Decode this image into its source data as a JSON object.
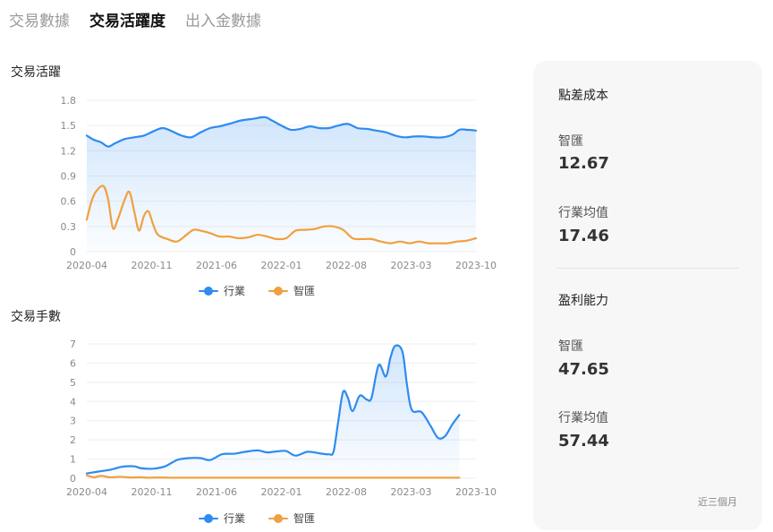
{
  "tabs": [
    {
      "label": "交易數據",
      "active": false
    },
    {
      "label": "交易活躍度",
      "active": true
    },
    {
      "label": "出入金數據",
      "active": false
    }
  ],
  "colors": {
    "industry": "#2e8bf0",
    "zhihui": "#f0a040"
  },
  "legend": {
    "industry": "行業",
    "zhihui": "智匯"
  },
  "chart_data": [
    {
      "type": "area",
      "title": "交易活躍",
      "ylim": [
        0,
        1.8
      ],
      "yticks": [
        "0",
        "0.3",
        "0.6",
        "0.9",
        "1.2",
        "1.5",
        "1.8"
      ],
      "xticks": [
        "2020-04",
        "2020-11",
        "2021-06",
        "2022-01",
        "2022-08",
        "2023-03",
        "2023-10"
      ],
      "series": [
        {
          "name": "行業",
          "color": "#2e8bf0",
          "fill": true,
          "points": [
            [
              0,
              1.38
            ],
            [
              0.3,
              1.33
            ],
            [
              0.6,
              1.3
            ],
            [
              0.9,
              1.25
            ],
            [
              1.2,
              1.29
            ],
            [
              1.6,
              1.34
            ],
            [
              2.0,
              1.36
            ],
            [
              2.4,
              1.38
            ],
            [
              2.8,
              1.43
            ],
            [
              3.2,
              1.47
            ],
            [
              3.6,
              1.43
            ],
            [
              4.0,
              1.38
            ],
            [
              4.4,
              1.36
            ],
            [
              4.8,
              1.42
            ],
            [
              5.2,
              1.47
            ],
            [
              5.6,
              1.49
            ],
            [
              6.0,
              1.52
            ],
            [
              6.5,
              1.56
            ],
            [
              7.0,
              1.58
            ],
            [
              7.5,
              1.6
            ],
            [
              7.8,
              1.56
            ],
            [
              8.2,
              1.5
            ],
            [
              8.6,
              1.45
            ],
            [
              9.0,
              1.46
            ],
            [
              9.4,
              1.49
            ],
            [
              9.8,
              1.47
            ],
            [
              10.2,
              1.47
            ],
            [
              10.6,
              1.5
            ],
            [
              11.0,
              1.52
            ],
            [
              11.4,
              1.47
            ],
            [
              11.8,
              1.46
            ],
            [
              12.2,
              1.44
            ],
            [
              12.6,
              1.42
            ],
            [
              13.0,
              1.38
            ],
            [
              13.4,
              1.36
            ],
            [
              13.8,
              1.37
            ],
            [
              14.2,
              1.37
            ],
            [
              14.6,
              1.36
            ],
            [
              15.0,
              1.36
            ],
            [
              15.4,
              1.39
            ],
            [
              15.7,
              1.45
            ],
            [
              16.0,
              1.45
            ],
            [
              16.4,
              1.44
            ]
          ]
        },
        {
          "name": "智匯",
          "color": "#f0a040",
          "fill": false,
          "points": [
            [
              0,
              0.38
            ],
            [
              0.2,
              0.6
            ],
            [
              0.4,
              0.72
            ],
            [
              0.7,
              0.78
            ],
            [
              0.9,
              0.62
            ],
            [
              1.1,
              0.28
            ],
            [
              1.3,
              0.38
            ],
            [
              1.6,
              0.62
            ],
            [
              1.8,
              0.71
            ],
            [
              2.0,
              0.48
            ],
            [
              2.2,
              0.25
            ],
            [
              2.4,
              0.42
            ],
            [
              2.6,
              0.48
            ],
            [
              2.8,
              0.32
            ],
            [
              3.0,
              0.2
            ],
            [
              3.4,
              0.15
            ],
            [
              3.8,
              0.12
            ],
            [
              4.2,
              0.2
            ],
            [
              4.5,
              0.26
            ],
            [
              4.8,
              0.25
            ],
            [
              5.2,
              0.22
            ],
            [
              5.6,
              0.18
            ],
            [
              6.0,
              0.18
            ],
            [
              6.4,
              0.16
            ],
            [
              6.8,
              0.17
            ],
            [
              7.2,
              0.2
            ],
            [
              7.6,
              0.18
            ],
            [
              8.0,
              0.15
            ],
            [
              8.4,
              0.16
            ],
            [
              8.8,
              0.25
            ],
            [
              9.2,
              0.26
            ],
            [
              9.6,
              0.27
            ],
            [
              10.0,
              0.3
            ],
            [
              10.4,
              0.3
            ],
            [
              10.8,
              0.26
            ],
            [
              11.2,
              0.16
            ],
            [
              11.6,
              0.15
            ],
            [
              12.0,
              0.15
            ],
            [
              12.4,
              0.12
            ],
            [
              12.8,
              0.1
            ],
            [
              13.2,
              0.12
            ],
            [
              13.6,
              0.1
            ],
            [
              14.0,
              0.12
            ],
            [
              14.4,
              0.1
            ],
            [
              14.8,
              0.1
            ],
            [
              15.2,
              0.1
            ],
            [
              15.6,
              0.12
            ],
            [
              16.0,
              0.13
            ],
            [
              16.4,
              0.16
            ]
          ]
        }
      ]
    },
    {
      "type": "area",
      "title": "交易手數",
      "ylim": [
        0,
        7
      ],
      "yticks": [
        "0",
        "1",
        "2",
        "3",
        "4",
        "5",
        "6",
        "7"
      ],
      "xticks": [
        "2020-04",
        "2020-11",
        "2021-06",
        "2022-01",
        "2022-08",
        "2023-03",
        "2023-10"
      ],
      "series": [
        {
          "name": "行業",
          "color": "#2e8bf0",
          "fill": true,
          "points": [
            [
              0,
              0.25
            ],
            [
              0.5,
              0.35
            ],
            [
              1.0,
              0.45
            ],
            [
              1.5,
              0.6
            ],
            [
              2.0,
              0.62
            ],
            [
              2.3,
              0.52
            ],
            [
              2.8,
              0.5
            ],
            [
              3.3,
              0.62
            ],
            [
              3.8,
              0.95
            ],
            [
              4.3,
              1.05
            ],
            [
              4.8,
              1.05
            ],
            [
              5.2,
              0.95
            ],
            [
              5.7,
              1.25
            ],
            [
              6.2,
              1.28
            ],
            [
              6.7,
              1.38
            ],
            [
              7.2,
              1.45
            ],
            [
              7.6,
              1.35
            ],
            [
              8.0,
              1.4
            ],
            [
              8.4,
              1.42
            ],
            [
              8.8,
              1.18
            ],
            [
              9.3,
              1.38
            ],
            [
              9.8,
              1.3
            ],
            [
              10.2,
              1.25
            ],
            [
              10.4,
              1.4
            ],
            [
              10.6,
              3.0
            ],
            [
              10.8,
              4.5
            ],
            [
              11.0,
              4.2
            ],
            [
              11.2,
              3.5
            ],
            [
              11.5,
              4.3
            ],
            [
              11.8,
              4.1
            ],
            [
              12.0,
              4.2
            ],
            [
              12.3,
              5.9
            ],
            [
              12.6,
              5.3
            ],
            [
              12.8,
              6.3
            ],
            [
              13.0,
              6.9
            ],
            [
              13.3,
              6.6
            ],
            [
              13.5,
              4.8
            ],
            [
              13.7,
              3.55
            ],
            [
              14.1,
              3.45
            ],
            [
              14.5,
              2.7
            ],
            [
              14.8,
              2.1
            ],
            [
              15.1,
              2.2
            ],
            [
              15.4,
              2.8
            ],
            [
              15.7,
              3.3
            ]
          ]
        },
        {
          "name": "智匯",
          "color": "#f0a040",
          "fill": false,
          "points": [
            [
              0,
              0.15
            ],
            [
              0.3,
              0.05
            ],
            [
              0.6,
              0.12
            ],
            [
              1.0,
              0.05
            ],
            [
              1.4,
              0.08
            ],
            [
              1.8,
              0.04
            ],
            [
              2.2,
              0.05
            ],
            [
              2.6,
              0.03
            ],
            [
              3.0,
              0.04
            ],
            [
              3.5,
              0.03
            ],
            [
              4.0,
              0.03
            ],
            [
              4.5,
              0.03
            ],
            [
              5.0,
              0.03
            ],
            [
              6.0,
              0.03
            ],
            [
              7.0,
              0.03
            ],
            [
              8.0,
              0.03
            ],
            [
              9.0,
              0.03
            ],
            [
              10.0,
              0.03
            ],
            [
              11.0,
              0.03
            ],
            [
              12.0,
              0.03
            ],
            [
              13.0,
              0.03
            ],
            [
              14.0,
              0.03
            ],
            [
              15.0,
              0.03
            ],
            [
              15.7,
              0.03
            ]
          ]
        }
      ]
    }
  ],
  "panel": {
    "sections": [
      {
        "title": "點差成本",
        "zhihui_label": "智匯",
        "zhihui_value": "12.67",
        "industry_label": "行業均值",
        "industry_value": "17.46"
      },
      {
        "title": "盈利能力",
        "zhihui_label": "智匯",
        "zhihui_value": "47.65",
        "industry_label": "行業均值",
        "industry_value": "57.44"
      }
    ],
    "footer": "近三個月"
  }
}
